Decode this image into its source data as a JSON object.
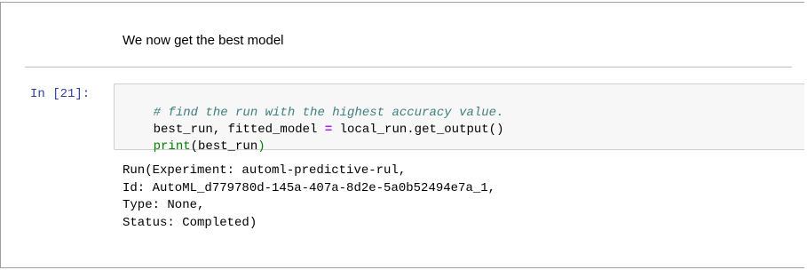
{
  "markdown_cell": {
    "text": "We now get the best model"
  },
  "code_cell": {
    "prompt": "In [21]:",
    "lines": [
      [
        {
          "text": "# find the run with the highest accuracy value.",
          "kind": "comment"
        }
      ],
      [
        {
          "text": "best_run, fitted_model ",
          "kind": "plain"
        },
        {
          "text": "=",
          "kind": "op"
        },
        {
          "text": " local_run.get_output()",
          "kind": "plain"
        }
      ],
      [
        {
          "text": "print",
          "kind": "builtin"
        },
        {
          "text": "(best_run",
          "kind": "plain"
        },
        {
          "text": ")",
          "kind": "builtin"
        }
      ]
    ]
  },
  "output": {
    "lines": [
      "Run(Experiment: automl-predictive-rul,",
      "Id: AutoML_d779780d-145a-407a-8d2e-5a0b52494e7a_1,",
      "Type: None,",
      "Status: Completed)"
    ]
  },
  "colors": {
    "prompt": "#303f9f",
    "comment": "#408080",
    "operator": "#aa22ff",
    "builtin": "#008000",
    "input_background": "#f7f7f7",
    "input_border": "#cfcfcf"
  }
}
